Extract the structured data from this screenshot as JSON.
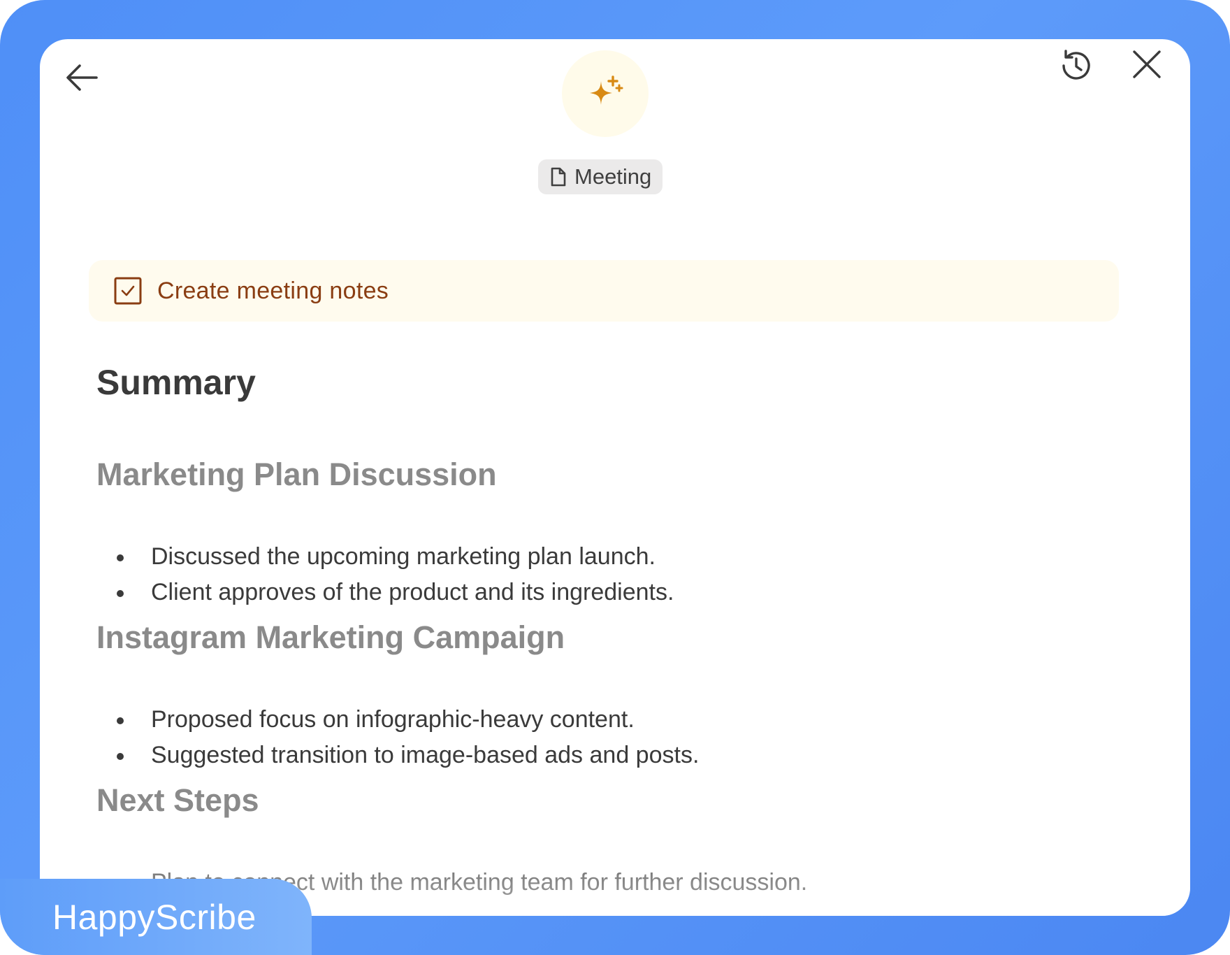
{
  "header": {
    "back_icon": "arrow-left-icon",
    "ai_icon": "sparkle-icon",
    "history_icon": "history-icon",
    "close_icon": "close-icon"
  },
  "chip": {
    "icon": "document-icon",
    "label": "Meeting"
  },
  "task": {
    "icon": "checkbox-checked-icon",
    "label": "Create meeting notes"
  },
  "content": {
    "summary_title": "Summary",
    "sections": [
      {
        "title": "Marketing Plan Discussion",
        "bullets": [
          "Discussed the upcoming marketing plan launch.",
          "Client approves of the product and its ingredients."
        ]
      },
      {
        "title": "Instagram Marketing Campaign",
        "bullets": [
          "Proposed focus on infographic-heavy content.",
          "Suggested transition to image-based ads and posts."
        ]
      },
      {
        "title": "Next Steps",
        "bullets": [
          "Plan to connect with the marketing team for further discussion."
        ]
      }
    ]
  },
  "brand": {
    "label": "HappyScribe"
  },
  "colors": {
    "background_blue": "#4f8ff7",
    "accent_orange": "#d88a14",
    "task_text": "#8a3d12",
    "task_bg": "#fffbee"
  }
}
